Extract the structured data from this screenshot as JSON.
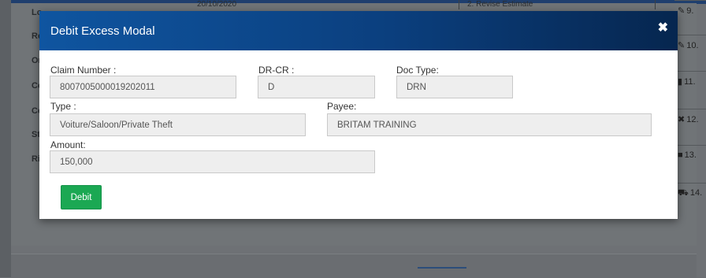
{
  "background": {
    "left_labels": [
      "Lo",
      "Re",
      "Or",
      "Co",
      "Co",
      "St",
      "Ri"
    ],
    "top_date": "20/10/2020",
    "top_cell": "2. Revise Estimate",
    "right_items": [
      {
        "icon": "edit-icon",
        "glyph": "✎",
        "text": "9."
      },
      {
        "icon": "edit-icon",
        "glyph": "✎",
        "text": "10."
      },
      {
        "icon": "file-icon",
        "glyph": "▮",
        "text": "11."
      },
      {
        "icon": "close-icon",
        "glyph": "✖",
        "text": "12."
      },
      {
        "icon": "folder-icon",
        "glyph": "■",
        "text": "13."
      },
      {
        "icon": "car-icon",
        "glyph": "⛟",
        "text": "14."
      }
    ]
  },
  "modal": {
    "title": "Debit Excess Modal",
    "close_glyph": "✖",
    "fields": {
      "claim_number": {
        "label": "Claim Number :",
        "value": "8007005000019202011"
      },
      "dr_cr": {
        "label": "DR-CR :",
        "value": "D"
      },
      "doc_type": {
        "label": "Doc Type:",
        "value": "DRN"
      },
      "type": {
        "label": "Type :",
        "value": "Voiture/Saloon/Private Theft"
      },
      "payee": {
        "label": "Payee:",
        "value": "BRITAM TRAINING"
      },
      "amount": {
        "label": "Amount:",
        "value": "150,000"
      }
    },
    "debit_button": "Debit"
  },
  "colors": {
    "header_start": "#0f55a0",
    "header_end": "#06264f",
    "button": "#1ba853",
    "field_bg": "#eeeeee"
  }
}
